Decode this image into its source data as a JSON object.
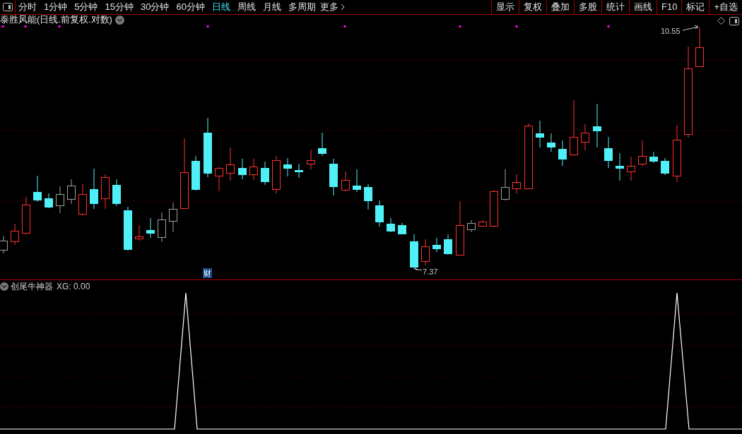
{
  "toolbar": {
    "periods": [
      {
        "label": "分时",
        "selected": false
      },
      {
        "label": "1分钟",
        "selected": false
      },
      {
        "label": "5分钟",
        "selected": false
      },
      {
        "label": "15分钟",
        "selected": false
      },
      {
        "label": "30分钟",
        "selected": false
      },
      {
        "label": "60分钟",
        "selected": false
      },
      {
        "label": "日线",
        "selected": true
      },
      {
        "label": "周线",
        "selected": false
      },
      {
        "label": "月线",
        "selected": false
      },
      {
        "label": "多周期",
        "selected": false
      }
    ],
    "more": "更多",
    "buttons": [
      "显示",
      "复权",
      "叠加",
      "多股",
      "统计",
      "画线",
      "F10",
      "标记",
      "+自选"
    ]
  },
  "main_chart": {
    "title": "泰胜风能(日线.前复权.对数)",
    "high_label": "10.55",
    "low_label": "7.37",
    "event_marker": "财"
  },
  "indicator": {
    "name": "创尾牛神器",
    "reading": "XG: 0.00"
  }
}
